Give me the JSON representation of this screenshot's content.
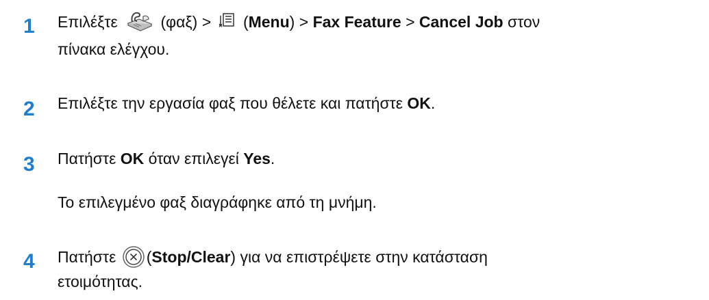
{
  "steps": [
    {
      "number": "1",
      "pre": "Επιλέξτε",
      "fax_word": "(φαξ)",
      "gt1": ">",
      "menu_open": "(",
      "menu": "Menu",
      "menu_close": ")",
      "gt2": ">",
      "fax_feature": "Fax Feature",
      "gt3": ">",
      "cancel_job": "Cancel Job",
      "post": "στον",
      "line2": "πίνακα ελέγχου."
    },
    {
      "number": "2",
      "pre": "Επιλέξτε την εργασία φαξ που θέλετε και πατήστε",
      "ok": "OK",
      "post": "."
    },
    {
      "number": "3",
      "pre": "Πατήστε",
      "ok": "OK",
      "mid": "όταν επιλεγεί",
      "yes": "Yes",
      "post": ".",
      "note": "Το επιλεγμένο φαξ διαγράφηκε από τη μνήμη."
    },
    {
      "number": "4",
      "pre": "Πατήστε",
      "open": "(",
      "stop_clear": "Stop/Clear",
      "close": ")",
      "post": "για να επιστρέψετε στην κατάσταση",
      "line2": "ετοιμότητας."
    }
  ],
  "icons": {
    "fax": "fax-icon",
    "menu": "menu-icon",
    "stop": "stop-clear-icon"
  },
  "colors": {
    "step_number": "#1e7fd0",
    "text": "#111111"
  }
}
